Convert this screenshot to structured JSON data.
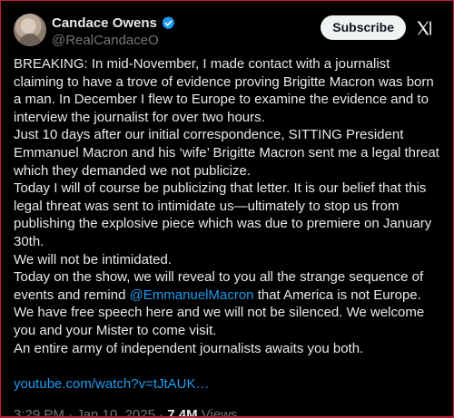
{
  "author": {
    "display_name": "Candace Owens",
    "handle": "@RealCandaceO",
    "verified_icon": "verified-badge-icon"
  },
  "actions": {
    "subscribe_label": "Subscribe",
    "grok_icon": "grok-icon"
  },
  "post": {
    "p1": "BREAKING: In mid-November, I made contact with a journalist claiming to have a trove of evidence proving Brigitte Macron was born a man. In December I flew to Europe to examine the evidence and to interview the journalist for over two hours.",
    "p2": "Just 10 days after our initial correspondence, SITTING President Emmanuel Macron and his ‘wife’ Brigitte Macron sent me a legal threat which they demanded we not publicize.",
    "p3": "Today I will of course be publicizing that letter. It is our belief that this legal threat was sent to intimidate us—ultimately to stop us from publishing the explosive piece which was due to premiere on January 30th.",
    "p4": "We will not be intimidated.",
    "p5_before": "Today on the show, we will reveal to you all the strange sequence of events and remind ",
    "p5_mention": "@EmmanuelMacron",
    "p5_after": " that America is not Europe. We have free speech here and we will not be silenced. We welcome you and your Mister to come visit.",
    "p6": "An entire army of independent journalists awaits you both.",
    "link": "youtube.com/watch?v=tJtAUK…"
  },
  "meta": {
    "time": "3:29 PM · Jan 10, 2025 · ",
    "views_count": "7.4M",
    "views_label": " Views"
  },
  "colors": {
    "background": "#000000",
    "text": "#e7e9ea",
    "muted": "#71767b",
    "link": "#1d9bf0",
    "frame_border": "#c0203a"
  }
}
